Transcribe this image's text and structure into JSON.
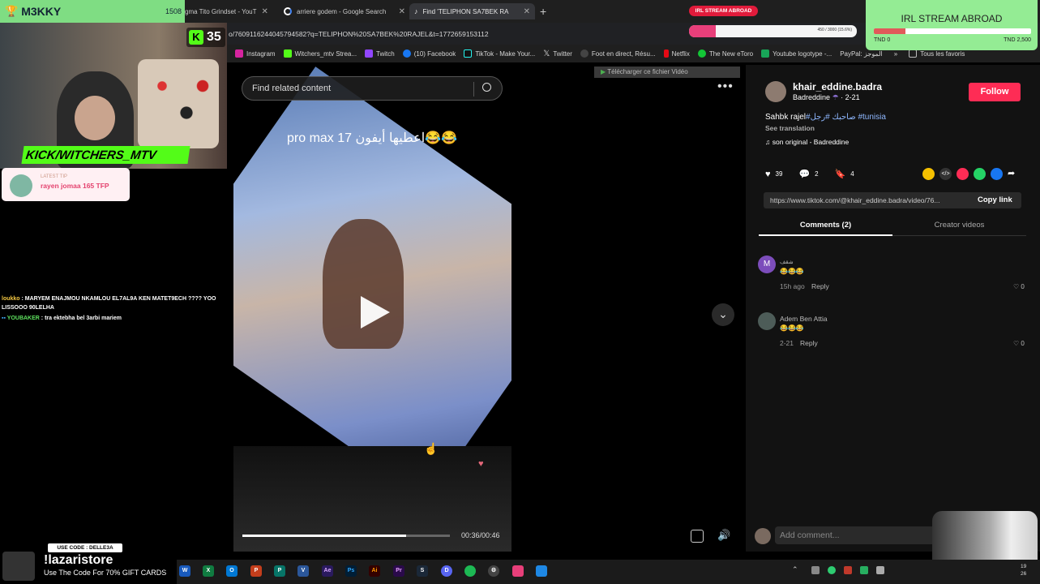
{
  "stream_overlay": {
    "streamer_name": "M3KKY",
    "trophy_count": "1508",
    "viewer_count": "35",
    "kick_channel": "KICK/WITCHERS_MTV",
    "latest_tip_heading": "LATEST TIP",
    "latest_tip_text": "rayen jomaa 165 TFP",
    "irl_badge": "IRL STREAM ABROAD",
    "goal_progress": "450 / 3000 (15.6%)",
    "goal_fraction": 0.16,
    "irl_title": "IRL STREAM ABROAD",
    "irl_min": "TND 0",
    "irl_max": "TND 2,500",
    "irl_fraction": 0.2,
    "chat": [
      {
        "user": "loukko",
        "message": " : MARYEM ENAJMOU NKAMLOU EL7AL9A KEN MATET9ECH ???? YOO LISSOOO 90LELHA"
      },
      {
        "user": "YOUBAKER",
        "message": " : tra ektebha bel 3arbi mariem"
      }
    ],
    "promo_code": "USE CODE : DELLE3A",
    "promo_store": "!lazaristore",
    "promo_text": "Use The Code For 70% GIFT CARDS"
  },
  "browser": {
    "tabs": [
      {
        "title": "gma Tito Grindset - YouT"
      },
      {
        "title": "arriere godem - Google Search"
      },
      {
        "title": "Find 'TELIPHON SA7BEK RA"
      }
    ],
    "address": "o/7609116244045794582?q=TELIPHON%20SA7BEK%20RAJEL&t=1772659153112",
    "bookmarks": [
      "Instagram",
      "Witchers_mtv Strea...",
      "Twitch",
      "(10) Facebook",
      "TikTok - Make Your...",
      "Twitter",
      "Foot en direct, Résu...",
      "Netflix",
      "The New eToro",
      "Youtube logotype -...",
      "PayPal: الموجز"
    ],
    "all_bookmarks": "Tous les favoris",
    "download_banner": "Télécharger ce fichier Vidéo"
  },
  "video": {
    "search_placeholder": "Find related content",
    "caption": "pro max 17 اعطيها أيفون😂😂",
    "time": "00:36/00:46",
    "progress_fraction": 0.79
  },
  "post": {
    "username": "khair_eddine.badra",
    "display_name": "Badreddine",
    "date": "2-21",
    "follow_label": "Follow",
    "description_plain": "Sahbk rajel",
    "description_tags": "#صاحبك #رجل #tunisia",
    "see_translation": "See translation",
    "sound": "son original - Badreddine",
    "likes": "39",
    "comments": "2",
    "saves": "4",
    "url": "https://www.tiktok.com/@khair_eddine.badra/video/76...",
    "copy_link": "Copy link",
    "tab_comments": "Comments (2)",
    "tab_creator": "Creator videos",
    "comment_list": [
      {
        "initial": "M",
        "name": "شقف",
        "text": "😂😂😂",
        "time": "15h ago",
        "reply": "Reply",
        "likes": "0"
      },
      {
        "initial": "",
        "name": "Adem Ben Attia",
        "text": "😂😂😂",
        "time": "2-21",
        "reply": "Reply",
        "likes": "0"
      }
    ],
    "add_comment": "Add comment..."
  },
  "taskbar": {
    "time": "19",
    "date": "26"
  }
}
